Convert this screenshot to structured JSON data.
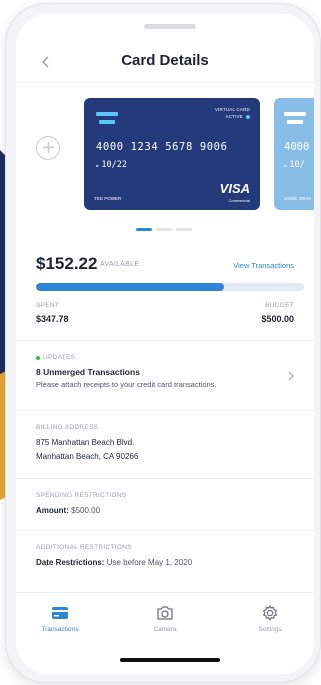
{
  "header": {
    "title": "Card Details",
    "back_icon": "chevron-left-icon"
  },
  "cards": [
    {
      "type_label": "VIRTUAL CARD",
      "status": "ACTIVE",
      "number": "4000 1234 5678 9006",
      "expiry": "10/22",
      "holder": "TED POWER",
      "brand": "VISA",
      "brand_sub": "Commercial",
      "color": "#243a7a"
    },
    {
      "number": "4000",
      "expiry": "10/",
      "holder": "JAMIE JOHN",
      "color": "#88bde8"
    }
  ],
  "pager": {
    "count": 3,
    "active": 0
  },
  "balance": {
    "amount": "$152.22",
    "available_label": "AVAILABLE",
    "view_transactions": "View Transactions",
    "spent_fraction": 0.7
  },
  "spent": {
    "label": "SPENT",
    "value": "$347.78"
  },
  "budget": {
    "label": "BUDGET",
    "value": "$500.00"
  },
  "updates": {
    "label": "UPDATES",
    "title": "8 Unmerged Transactions",
    "description": "Please attach receipts to your credit card transactions."
  },
  "billing": {
    "label": "BILLING ADDRESS",
    "line1": "875 Manhattan Beach Blvd.",
    "line2": "Manhattan Beach, CA 90266"
  },
  "spending": {
    "label": "SPENDING RESTRICTIONS",
    "key": "Amount:",
    "value": "$500.00"
  },
  "additional": {
    "label": "ADDITIONAL RESTRICTIONS",
    "key": "Date Restrictions:",
    "value": "Use before May 1, 2020"
  },
  "tabs": [
    {
      "label": "Transactions",
      "icon": "card-icon",
      "active": true
    },
    {
      "label": "Camera",
      "icon": "camera-icon",
      "active": false
    },
    {
      "label": "Settings",
      "icon": "gear-icon",
      "active": false
    }
  ],
  "colors": {
    "accent": "#2e86d6",
    "navy": "#243a7a",
    "update_dot": "#3bb54a"
  }
}
